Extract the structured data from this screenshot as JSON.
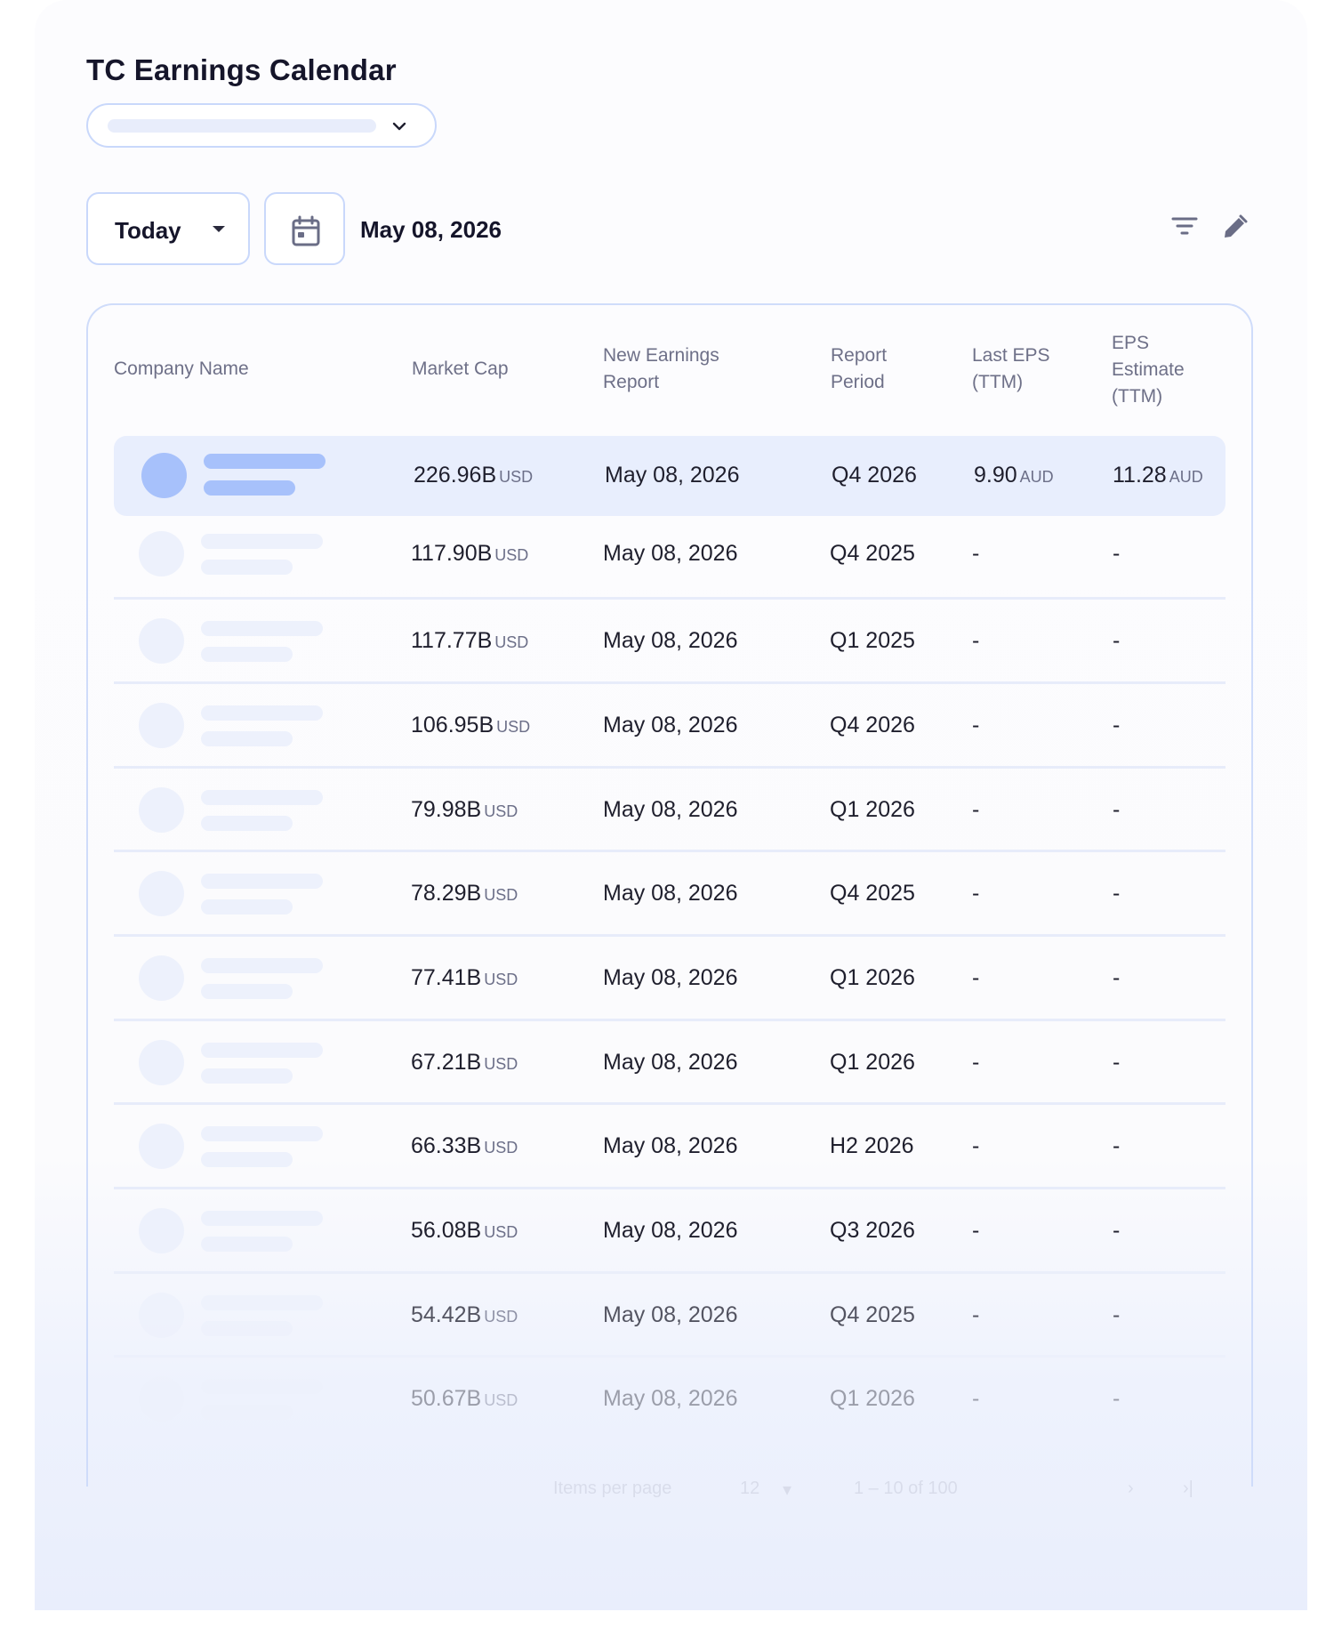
{
  "page": {
    "title": "TC Earnings Calendar"
  },
  "toolbar": {
    "period": "Today",
    "selected_date": "May 08, 2026"
  },
  "icons": {
    "account_dropdown": "chevron-down-icon",
    "period_caret": "caret-down-icon",
    "calendar": "calendar-icon",
    "filter": "filter-icon",
    "edit": "pencil-icon"
  },
  "colors": {
    "accent_border": "#c9d8fb",
    "highlight_row": "#e8eefd",
    "skeleton_active": "#a7c1fb",
    "skeleton_idle": "#edf1fc"
  },
  "table": {
    "columns": {
      "company_name": "Company Name",
      "market_cap": "Market Cap",
      "new_earnings_report": "New Earnings Report",
      "report_period": "Report Period",
      "last_eps": "Last EPS (TTM)",
      "eps_estimate": "EPS Estimate (TTM)"
    },
    "rows": [
      {
        "market_cap": "226.96B",
        "cap_unit": "USD",
        "report_date": "May 08, 2026",
        "period": "Q4 2026",
        "last_eps": "9.90",
        "last_eps_unit": "AUD",
        "eps_estimate": "11.28",
        "eps_estimate_unit": "AUD"
      },
      {
        "market_cap": "117.90B",
        "cap_unit": "USD",
        "report_date": "May 08, 2026",
        "period": "Q4 2025",
        "last_eps": "-",
        "eps_estimate": "-"
      },
      {
        "market_cap": "117.77B",
        "cap_unit": "USD",
        "report_date": "May 08, 2026",
        "period": "Q1 2025",
        "last_eps": "-",
        "eps_estimate": "-"
      },
      {
        "market_cap": "106.95B",
        "cap_unit": "USD",
        "report_date": "May 08, 2026",
        "period": "Q4 2026",
        "last_eps": "-",
        "eps_estimate": "-"
      },
      {
        "market_cap": "79.98B",
        "cap_unit": "USD",
        "report_date": "May 08, 2026",
        "period": "Q1 2026",
        "last_eps": "-",
        "eps_estimate": "-"
      },
      {
        "market_cap": "78.29B",
        "cap_unit": "USD",
        "report_date": "May 08, 2026",
        "period": "Q4 2025",
        "last_eps": "-",
        "eps_estimate": "-"
      },
      {
        "market_cap": "77.41B",
        "cap_unit": "USD",
        "report_date": "May 08, 2026",
        "period": "Q1 2026",
        "last_eps": "-",
        "eps_estimate": "-"
      },
      {
        "market_cap": "67.21B",
        "cap_unit": "USD",
        "report_date": "May 08, 2026",
        "period": "Q1 2026",
        "last_eps": "-",
        "eps_estimate": "-"
      },
      {
        "market_cap": "66.33B",
        "cap_unit": "USD",
        "report_date": "May 08, 2026",
        "period": "H2 2026",
        "last_eps": "-",
        "eps_estimate": "-"
      },
      {
        "market_cap": "56.08B",
        "cap_unit": "USD",
        "report_date": "May 08, 2026",
        "period": "Q3 2026",
        "last_eps": "-",
        "eps_estimate": "-"
      },
      {
        "market_cap": "54.42B",
        "cap_unit": "USD",
        "report_date": "May 08, 2026",
        "period": "Q4 2025",
        "last_eps": "-",
        "eps_estimate": "-"
      },
      {
        "market_cap": "50.67B",
        "cap_unit": "USD",
        "report_date": "May 08, 2026",
        "period": "Q1 2026",
        "last_eps": "-",
        "eps_estimate": "-"
      }
    ]
  },
  "pagination": {
    "items_per_page_label": "Items per page",
    "items_per_page": "12",
    "range": "1 – 10 of 100"
  }
}
